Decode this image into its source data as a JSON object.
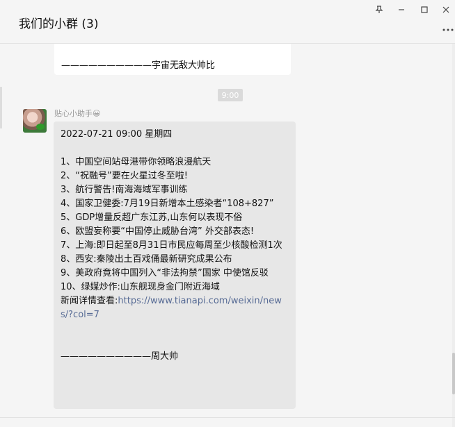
{
  "window": {
    "title": "我们的小群 (3)",
    "controls": [
      "pin-icon",
      "minimize-icon",
      "maximize-icon",
      "close-icon"
    ],
    "more_label": "⋮"
  },
  "messages": {
    "prev_tail": "——————————宇宙无敌大帅比",
    "time_divider": "9:00",
    "sender": "贴心小助手😀",
    "news_lines": [
      "2022-07-21 09:00 星期四",
      "",
      "1、中国空间站母港带你领略浪漫航天",
      "2、“祝融号”要在火星过冬至啦!",
      "3、航行警告!南海海域军事训练",
      "4、国家卫健委:7月19日新增本土感染者“108+827”",
      "5、GDP增量反超广东江苏,山东何以表现不俗",
      "6、欧盟妄称要“中国停止威胁台湾” 外交部表态!",
      "7、上海:即日起至8月31日市民应每周至少核酸检测1次",
      "8、西安:秦陵出土百戏俑最新研究成果公布",
      "9、美政府竟将中国列入“非法拘禁”国家 中使馆反驳",
      "10、绿媒炒作:山东舰现身金门附近海域"
    ],
    "link_prefix": "新闻详情查看:",
    "link_url": "https://www.tianapi.com/weixin/news/?col=7",
    "signature": "——————————周大帅"
  }
}
